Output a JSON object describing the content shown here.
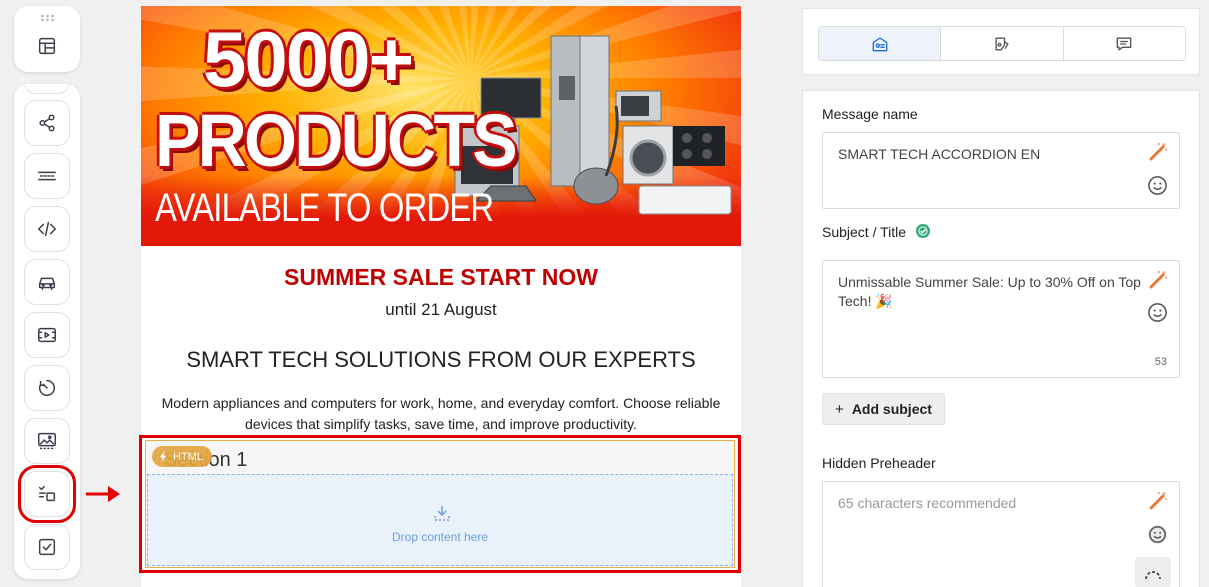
{
  "toolbar": {
    "tools": [
      {
        "name": "layout-icon"
      },
      {
        "name": "share-icon"
      },
      {
        "name": "divider-icon"
      },
      {
        "name": "code-icon"
      },
      {
        "name": "car-icon"
      },
      {
        "name": "video-icon"
      },
      {
        "name": "timer-icon"
      },
      {
        "name": "image-icon"
      },
      {
        "name": "accordion-icon",
        "active": true
      },
      {
        "name": "checkbox-icon"
      }
    ],
    "highlight_color": "#e00000"
  },
  "email": {
    "banner": {
      "line1": "5000+",
      "line2": "PRODUCTS",
      "line3": "AVAILABLE TO ORDER"
    },
    "sale_heading": "SUMMER SALE START NOW",
    "until": "until 21 August",
    "heading": "SMART TECH SOLUTIONS FROM OUR EXPERTS",
    "paragraph": "Modern appliances and computers for work, home, and everyday comfort. Choose reliable devices that simplify tasks, save time, and improve productivity.",
    "section": {
      "title": "Section 1",
      "badge": "HTML",
      "drop_text": "Drop content here"
    }
  },
  "panel": {
    "tabs": [
      {
        "icon": "settings-card-icon",
        "active": true
      },
      {
        "icon": "paint-icon",
        "active": false
      },
      {
        "icon": "comment-icon",
        "active": false
      }
    ],
    "message_name": {
      "label": "Message name",
      "value": "SMART TECH ACCORDION EN"
    },
    "subject": {
      "label": "Subject / Title",
      "value": "Unmissable Summer Sale: Up to 30% Off on Top Tech! 🎉",
      "counter": "53"
    },
    "add_subject": "Add subject",
    "preheader": {
      "label": "Hidden Preheader",
      "placeholder": "65 characters recommended"
    },
    "accent_color": "#1f6fd1",
    "valid_color": "#2aa876"
  }
}
